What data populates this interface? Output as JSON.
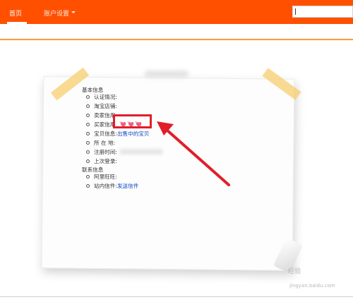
{
  "nav": {
    "home": "首页",
    "account": "账户设置",
    "search_value": ""
  },
  "profile": {
    "basic_header": "基本信息",
    "fields": {
      "auth": "认证情况:",
      "shop": "淘宝店铺:",
      "seller_credit": "卖家信用",
      "buyer_credit": "买家信用",
      "items_label": "宝贝信息:",
      "items_link": "出售中的宝贝",
      "location": "所 在 地:",
      "reg_time": "注册时间:",
      "last_login": "上次登录:"
    },
    "contact_header": "联系信息",
    "contact": {
      "aliwangwang": "阿里旺旺:",
      "mail_label": "站内信件:",
      "mail_link": "发送信件"
    }
  },
  "buyer_credit_hearts": "💘💘💘",
  "watermark": {
    "logo_text": "经验",
    "domain": "jingyan.baidu.com"
  },
  "colors": {
    "topbar": "#ff5000",
    "highlight": "#e01f2b",
    "link": "#0a45c6"
  },
  "icons": [
    "chevron-down-icon",
    "heart-icon",
    "arrow-icon"
  ]
}
